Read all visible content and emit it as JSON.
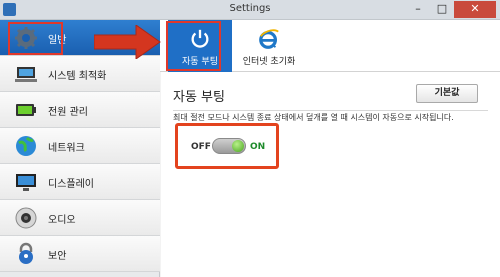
{
  "window": {
    "title": "Settings",
    "minimize_symbol": "–",
    "maximize_symbol": "□",
    "close_symbol": "✕"
  },
  "sidebar": {
    "items": [
      {
        "label": "일반",
        "icon": "gear-icon",
        "active": true
      },
      {
        "label": "시스템 최적화",
        "icon": "laptop-icon",
        "active": false
      },
      {
        "label": "전원 관리",
        "icon": "battery-icon",
        "active": false
      },
      {
        "label": "네트워크",
        "icon": "globe-icon",
        "active": false
      },
      {
        "label": "디스플레이",
        "icon": "monitor-icon",
        "active": false
      },
      {
        "label": "오디오",
        "icon": "speaker-icon",
        "active": false
      },
      {
        "label": "보안",
        "icon": "lock-icon",
        "active": false
      }
    ]
  },
  "tabs": [
    {
      "label": "자동 부팅",
      "icon": "power-icon",
      "active": true
    },
    {
      "label": "인터넷 초기화",
      "icon": "ie-icon",
      "active": false
    }
  ],
  "content": {
    "title": "자동 부팅",
    "default_button": "기본값",
    "description": "최대 절전 모드나 시스템 종료 상태에서 덮개를 열 때 시스템이 자동으로 시작됩니다.",
    "toggle": {
      "off_label": "OFF",
      "on_label": "ON",
      "state": "on"
    }
  },
  "colors": {
    "accent_blue": "#1f6fc6",
    "highlight_red": "#e0382b",
    "on_green": "#1d8a2a"
  }
}
